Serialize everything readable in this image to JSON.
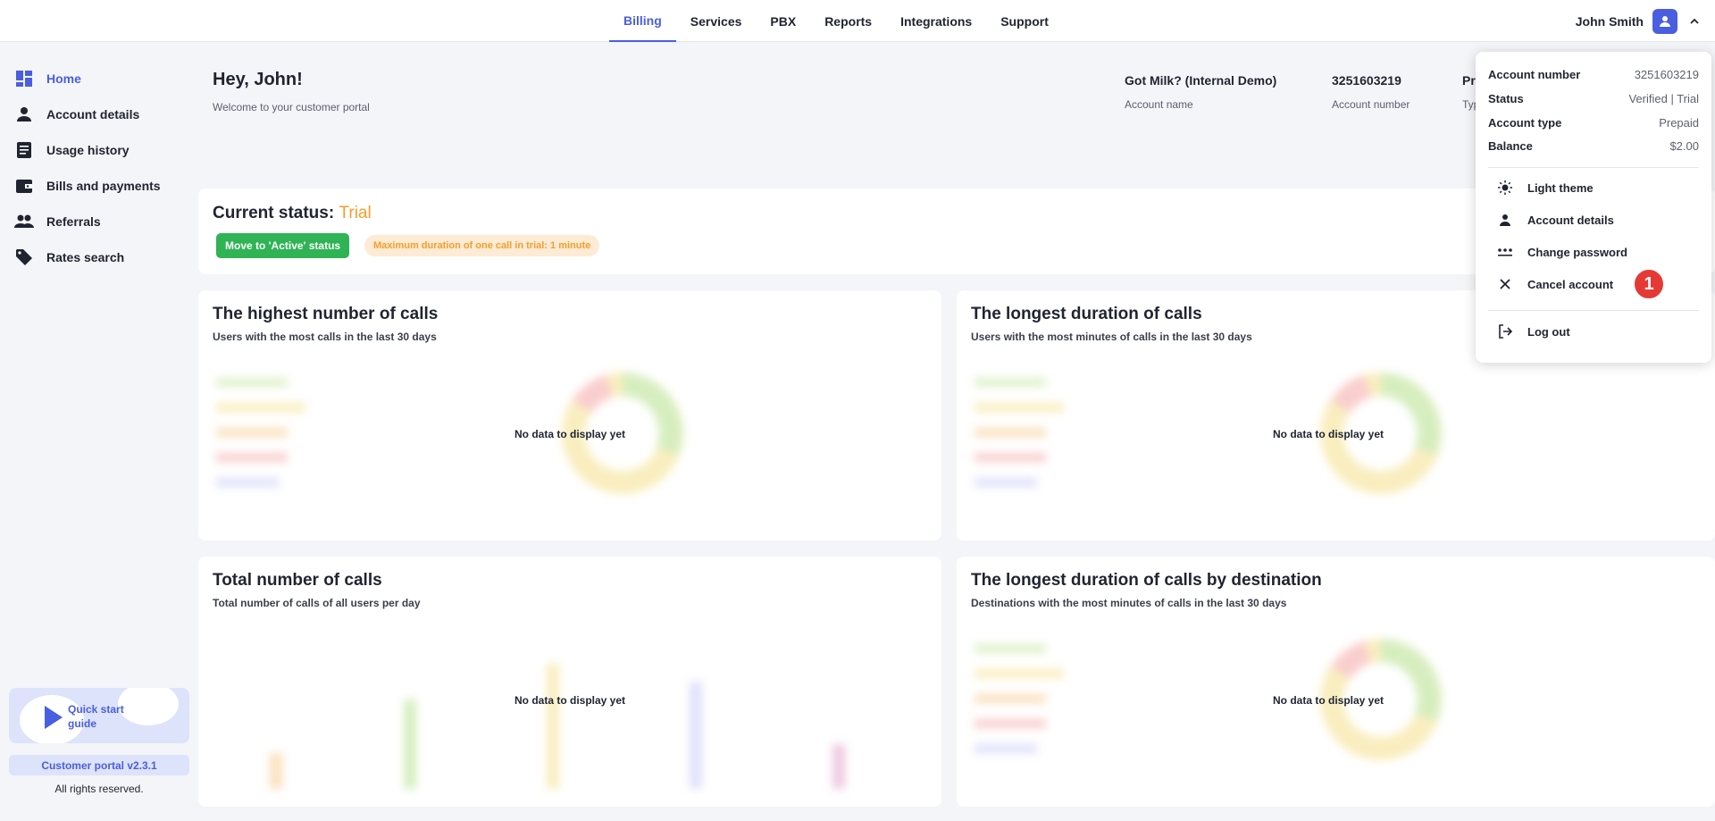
{
  "nav": {
    "tabs": [
      {
        "label": "Billing"
      },
      {
        "label": "Services"
      },
      {
        "label": "PBX"
      },
      {
        "label": "Reports"
      },
      {
        "label": "Integrations"
      },
      {
        "label": "Support"
      }
    ],
    "active_tab": "Billing",
    "user_name": "John Smith"
  },
  "sidebar": {
    "items": [
      {
        "label": "Home",
        "icon": "dashboard-icon"
      },
      {
        "label": "Account details",
        "icon": "person-icon"
      },
      {
        "label": "Usage history",
        "icon": "document-icon"
      },
      {
        "label": "Bills and payments",
        "icon": "wallet-icon"
      },
      {
        "label": "Referrals",
        "icon": "people-icon"
      },
      {
        "label": "Rates search",
        "icon": "tag-icon"
      }
    ],
    "quick_start": "Quick start guide",
    "version": "Customer portal v2.3.1",
    "rights": "All rights reserved."
  },
  "header": {
    "greeting": "Hey, John!",
    "welcome": "Welcome to your customer portal",
    "account_name_value": "Got Milk? (Internal Demo)",
    "account_name_label": "Account name",
    "account_number_value": "3251603219",
    "account_number_label": "Account number",
    "type_value_partial": "Pr",
    "type_label_partial": "Typ"
  },
  "status": {
    "title": "Current status:",
    "value": "Trial",
    "button": "Move to 'Active' status",
    "badge": "Maximum duration of one call in trial: 1 minute"
  },
  "widgets": [
    {
      "title": "The highest number of calls",
      "subtitle": "Users with the most calls in the last 30 days",
      "empty": "No data to display yet"
    },
    {
      "title": "The longest duration of calls",
      "subtitle": "Users with the most minutes of calls in the last 30 days",
      "empty": "No data to display yet"
    },
    {
      "title": "Total number of calls",
      "subtitle": "Total number of calls of all users per day",
      "empty": "No data to display yet"
    },
    {
      "title": "The longest duration of calls by destination",
      "subtitle": "Destinations with the most minutes of calls in the last 30 days",
      "empty": "No data to display yet"
    }
  ],
  "dropdown": {
    "rows": [
      {
        "key": "Account number",
        "value": "3251603219"
      },
      {
        "key": "Status",
        "value": "Verified | Trial"
      },
      {
        "key": "Account type",
        "value": "Prepaid"
      },
      {
        "key": "Balance",
        "value": "$2.00"
      }
    ],
    "items": [
      {
        "label": "Light theme",
        "icon": "sun-icon"
      },
      {
        "label": "Account details",
        "icon": "person-icon"
      },
      {
        "label": "Change password",
        "icon": "password-dots-icon"
      },
      {
        "label": "Cancel account",
        "icon": "close-icon"
      },
      {
        "label": "Log out",
        "icon": "logout-icon"
      }
    ],
    "marker": "1"
  },
  "colors": {
    "accent": "#4a5ee0",
    "trial": "#f59e2a",
    "active_button": "#2fb355",
    "marker": "#e53935"
  }
}
